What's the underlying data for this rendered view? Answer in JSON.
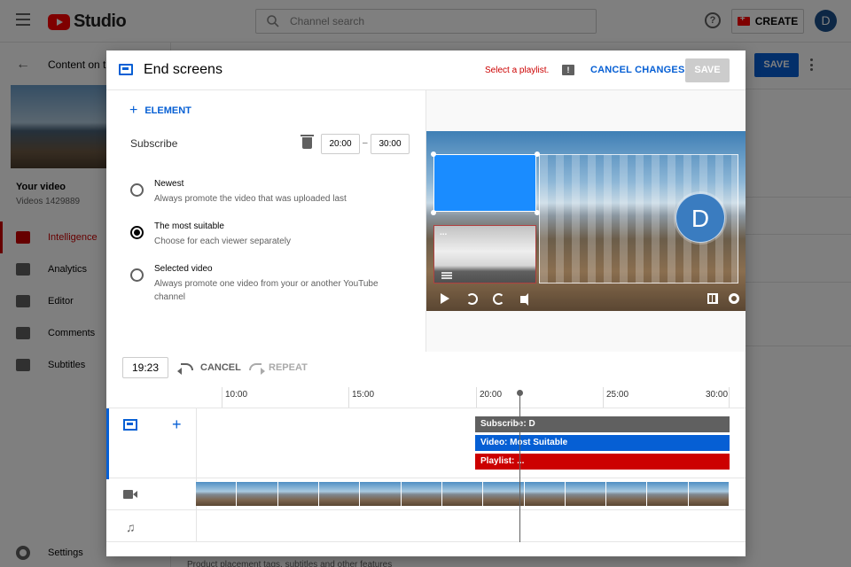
{
  "app": {
    "logo_text": "Studio",
    "search_placeholder": "Channel search",
    "help_icon": "?",
    "create_label": "CREATE",
    "avatar_initial": "D"
  },
  "sidebar": {
    "back_label": "Content on th",
    "video_title": "Your video",
    "video_subtitle": "Videos 1429889",
    "items": [
      {
        "label": "Intelligence",
        "icon": "pencil-icon",
        "active": true
      },
      {
        "label": "Analytics",
        "icon": "analytics-icon",
        "active": false
      },
      {
        "label": "Editor",
        "icon": "editor-icon",
        "active": false
      },
      {
        "label": "Comments",
        "icon": "comments-icon",
        "active": false
      },
      {
        "label": "Subtitles",
        "icon": "subtitles-icon",
        "active": false
      }
    ],
    "settings_label": "Settings"
  },
  "background": {
    "save_label": "SAVE",
    "footer_text": "Product placement tags, subtitles and other features"
  },
  "modal": {
    "title": "End screens",
    "error_text": "Select a playlist.",
    "cancel_changes_label": "CANCEL CHANGES",
    "save_label": "SAVE",
    "add_element_label": "ELEMENT",
    "element_name": "Subscribe",
    "start_time": "20:00",
    "dash": "–",
    "end_time": "30:00",
    "options": [
      {
        "title": "Newest",
        "description": "Always promote the video that was uploaded last",
        "checked": false
      },
      {
        "title": "The most suitable",
        "description": "Choose for each viewer separately",
        "checked": true
      },
      {
        "title": "Selected video",
        "description": "Always promote one video from your or another YouTube channel",
        "checked": false
      }
    ],
    "preview": {
      "playlist_overlay_text": "...",
      "subscribe_initial": "D"
    },
    "toolbar": {
      "current_time": "19:23",
      "cancel_label": "CANCEL",
      "repeat_label": "REPEAT"
    },
    "timeline": {
      "ticks": [
        "10:00",
        "15:00",
        "20:00",
        "25:00",
        "30:00"
      ],
      "bars": [
        {
          "label": "Subscribe: D",
          "color": "#606060"
        },
        {
          "label": "Video: Most Suitable",
          "color": "#065fd4"
        },
        {
          "label": "Playlist: ...",
          "color": "#cc0000"
        }
      ]
    }
  },
  "colors": {
    "accent_blue": "#065fd4",
    "brand_red": "#ff0000",
    "error_red": "#cc0000"
  }
}
